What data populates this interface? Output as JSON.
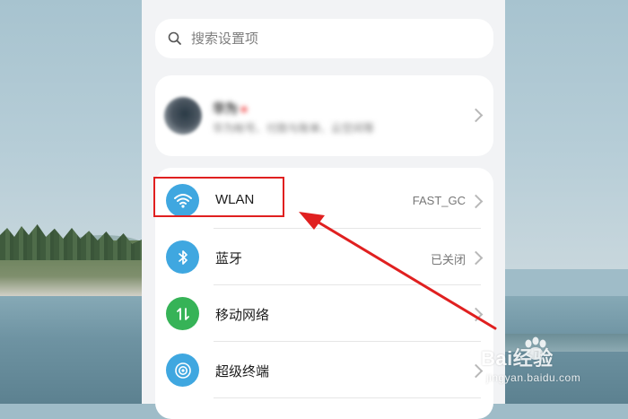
{
  "search": {
    "placeholder": "搜索设置项"
  },
  "account": {
    "name": "华为",
    "subtitle": "华为帐号、付款与账单、云空间等"
  },
  "settings_items": [
    {
      "label": "WLAN",
      "value": "FAST_GC",
      "icon": "wifi-icon",
      "color": "#3fa7e0"
    },
    {
      "label": "蓝牙",
      "value": "已关闭",
      "icon": "bluetooth-icon",
      "color": "#3fa7e0"
    },
    {
      "label": "移动网络",
      "value": "",
      "icon": "mobile-network-icon",
      "color": "#36b357"
    },
    {
      "label": "超级终端",
      "value": "",
      "icon": "super-device-icon",
      "color": "#3fa7e0"
    }
  ],
  "annotation": {
    "highlight_color": "#e02020",
    "target": "WLAN"
  },
  "watermark": {
    "brand": "Bai经验",
    "url": "jingyan.baidu.com"
  }
}
